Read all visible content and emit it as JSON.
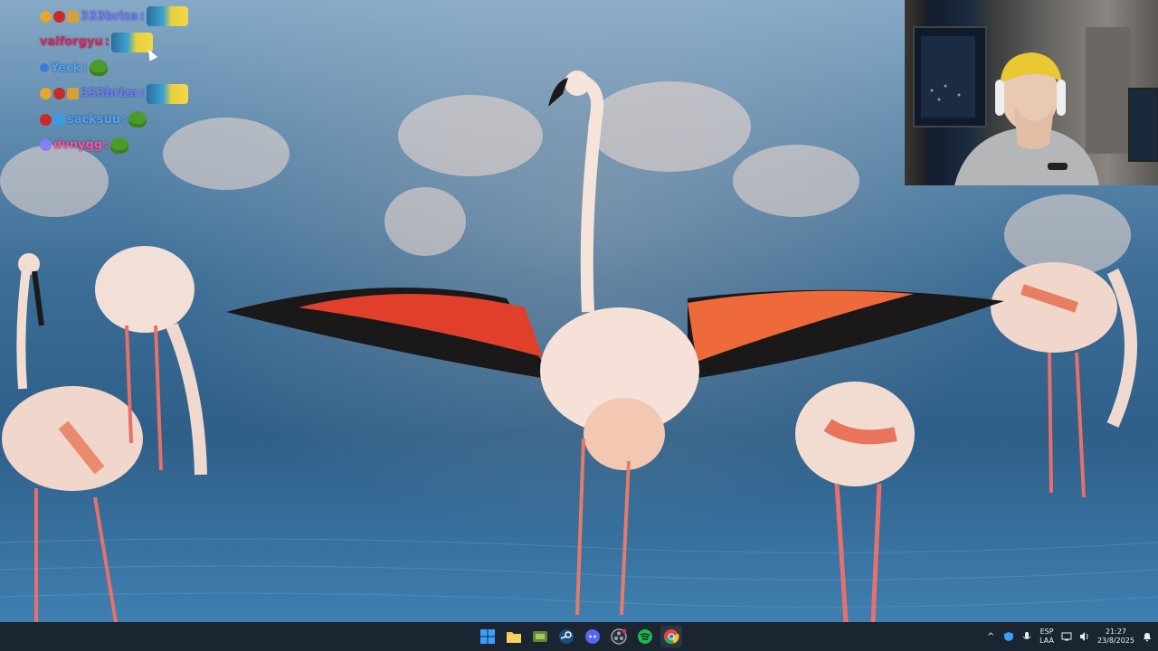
{
  "chat": {
    "messages": [
      {
        "user": "333briza",
        "color": "#6e7cff"
      },
      {
        "user": "valforgyu",
        "color": "#e0245e"
      },
      {
        "user": "Yeck",
        "color": "#4aa3ff"
      },
      {
        "user": "333briza",
        "color": "#6e7cff"
      },
      {
        "user": "sacksuu",
        "color": "#4fa3ff"
      },
      {
        "user": "dvnygg",
        "color": "#ff4fa0"
      }
    ],
    "separator": ":"
  },
  "taskbar": {
    "apps": [
      {
        "name": "start-icon",
        "color": "#3aa0ff"
      },
      {
        "name": "file-explorer-icon",
        "color": "#f4c542"
      },
      {
        "name": "app-icon",
        "color": "#5b8a3a"
      },
      {
        "name": "steam-icon",
        "color": "#1b4f80"
      },
      {
        "name": "discord-icon",
        "color": "#5865f2"
      },
      {
        "name": "obs-icon",
        "color": "#9aa5b0"
      },
      {
        "name": "spotify-icon",
        "color": "#1db954"
      },
      {
        "name": "chrome-icon",
        "color": "#e34a3a"
      }
    ],
    "language": {
      "line1": "ESP",
      "line2": "LAA"
    },
    "time": "21:27",
    "date": "23/8/2025"
  }
}
